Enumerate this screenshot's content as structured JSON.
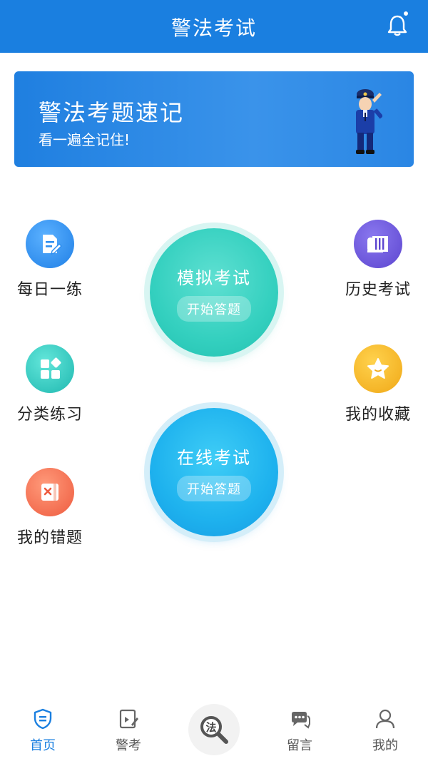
{
  "header": {
    "title": "警法考试"
  },
  "banner": {
    "title": "警法考题速记",
    "subtitle": "看一遍全记住!"
  },
  "left_items": [
    {
      "label": "每日一练",
      "icon": "document-edit-icon",
      "color": "#2f8ff0"
    },
    {
      "label": "分类练习",
      "icon": "category-grid-icon",
      "color": "#2fc7c0"
    },
    {
      "label": "我的错题",
      "icon": "wrong-answers-icon",
      "color": "#f06a4a"
    }
  ],
  "right_items": [
    {
      "label": "历史考试",
      "icon": "history-scroll-icon",
      "color": "#6a55d8"
    },
    {
      "label": "我的收藏",
      "icon": "star-icon",
      "color": "#f4b21d"
    }
  ],
  "main_buttons": [
    {
      "title": "模拟考试",
      "subtitle": "开始答题"
    },
    {
      "title": "在线考试",
      "subtitle": "开始答题"
    }
  ],
  "tabbar": {
    "tabs": [
      {
        "label": "首页",
        "icon": "home-shield-icon",
        "active": true
      },
      {
        "label": "警考",
        "icon": "exam-edit-icon",
        "active": false
      },
      {
        "label": "留言",
        "icon": "message-icon",
        "active": false
      },
      {
        "label": "我的",
        "icon": "profile-icon",
        "active": false
      }
    ],
    "center_glyph": "法",
    "center_icon": "law-search-icon"
  },
  "colors": {
    "primary": "#1a7fe0",
    "teal": "#2fd3c3",
    "blue_button": "#1ba9ea"
  }
}
